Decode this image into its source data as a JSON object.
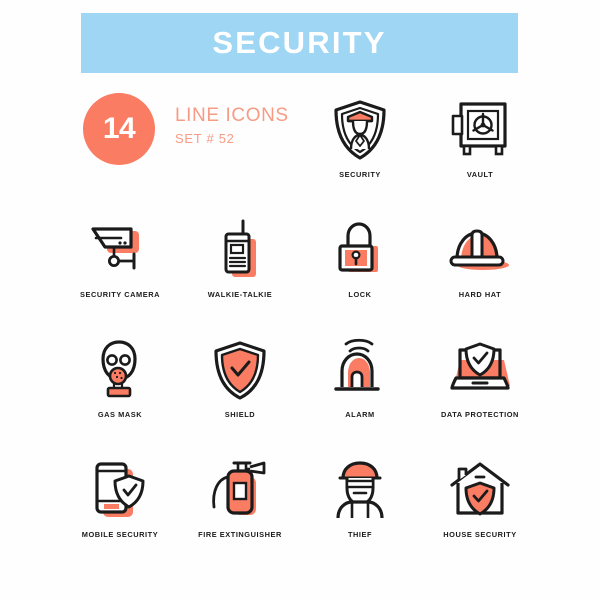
{
  "header": {
    "title": "SECURITY",
    "banner_color": "#9ed6f4",
    "title_color": "#ffffff"
  },
  "intro": {
    "count": "14",
    "count_circle_color": "#fa7d63",
    "line1": "LINE ICONS",
    "line2": "SET # 52",
    "text_color": "#f79b85"
  },
  "palette": {
    "accent": "#fa7d63",
    "stroke": "#1b1b1b",
    "background": "#fefefe",
    "label": "#1b1b1b"
  },
  "grid": {
    "columns": 4,
    "rows": [
      {
        "cells": [
          {
            "icon": "none",
            "label": "",
            "empty": true
          },
          {
            "icon": "none",
            "label": "",
            "empty": true
          },
          {
            "icon": "security-shield-guard-icon",
            "label": "SECURITY",
            "empty": false
          },
          {
            "icon": "vault-icon",
            "label": "VAULT",
            "empty": false
          }
        ]
      },
      {
        "cells": [
          {
            "icon": "security-camera-icon",
            "label": "SECURITY CAMERA",
            "empty": false
          },
          {
            "icon": "walkie-talkie-icon",
            "label": "WALKIE-TALKIE",
            "empty": false
          },
          {
            "icon": "lock-icon",
            "label": "LOCK",
            "empty": false
          },
          {
            "icon": "hard-hat-icon",
            "label": "HARD HAT",
            "empty": false
          }
        ]
      },
      {
        "cells": [
          {
            "icon": "gas-mask-icon",
            "label": "GAS MASK",
            "empty": false
          },
          {
            "icon": "shield-icon",
            "label": "SHIELD",
            "empty": false
          },
          {
            "icon": "alarm-icon",
            "label": "ALARM",
            "empty": false
          },
          {
            "icon": "data-protection-icon",
            "label": "DATA PROTECTION",
            "empty": false
          }
        ]
      },
      {
        "cells": [
          {
            "icon": "mobile-security-icon",
            "label": "MOBILE SECURITY",
            "empty": false
          },
          {
            "icon": "fire-extinguisher-icon",
            "label": "FIRE EXTINGUISHER",
            "empty": false
          },
          {
            "icon": "thief-icon",
            "label": "THIEF",
            "empty": false
          },
          {
            "icon": "house-security-icon",
            "label": "HOUSE SECURITY",
            "empty": false
          }
        ]
      }
    ]
  }
}
